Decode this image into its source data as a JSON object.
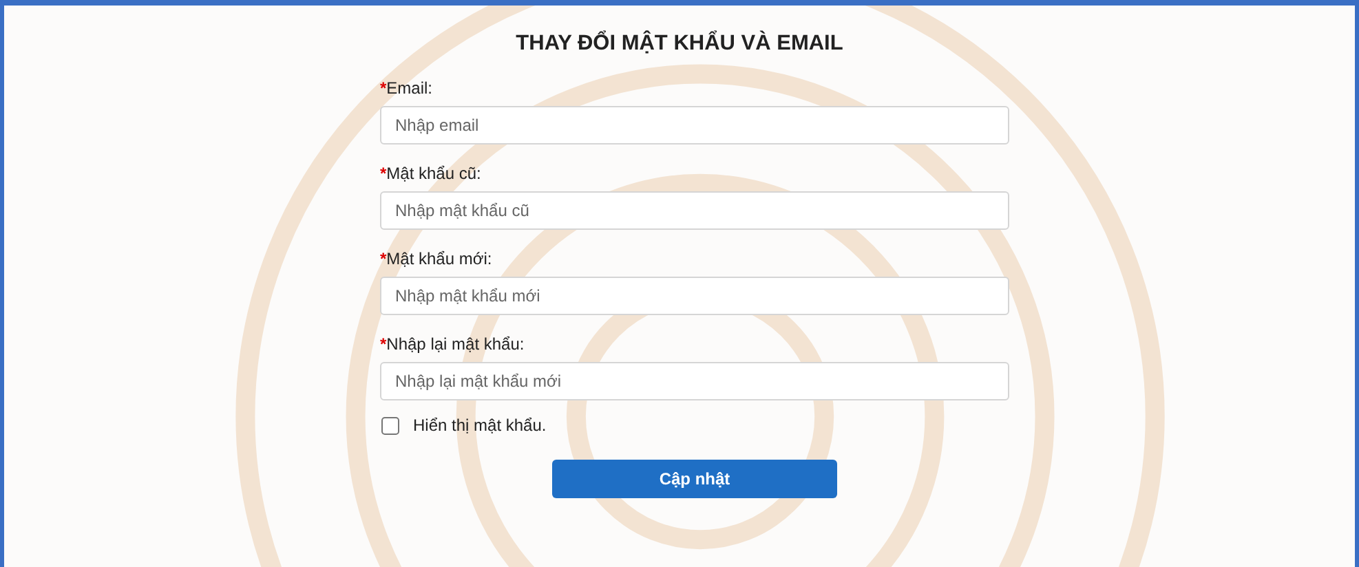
{
  "title": "THAY ĐỔI MẬT KHẨU VÀ EMAIL",
  "fields": [
    {
      "marker": "*",
      "label": "Email:",
      "placeholder": "Nhập email"
    },
    {
      "marker": "*",
      "label": "Mật khẩu cũ:",
      "placeholder": "Nhập mật khẩu cũ"
    },
    {
      "marker": "*",
      "label": "Mật khẩu mới:",
      "placeholder": "Nhập mật khẩu mới"
    },
    {
      "marker": "*",
      "label": "Nhập lại mật khẩu:",
      "placeholder": "Nhập lại mật khẩu mới"
    }
  ],
  "show_password": {
    "label": "Hiển thị mật khẩu.",
    "checked": false
  },
  "submit": "Cập nhật"
}
